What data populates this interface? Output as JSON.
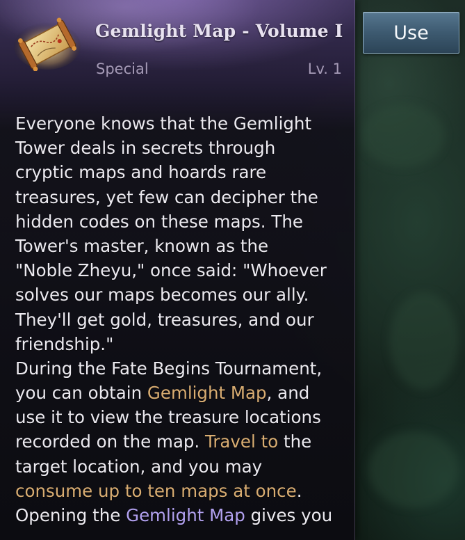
{
  "item": {
    "icon": "treasure-map-scroll-icon",
    "name": "Gemlight Map - Volume I",
    "category": "Special",
    "level": "Lv. 1"
  },
  "colors": {
    "text": "#eceaf0",
    "subtext": "#a59ab6",
    "highlight_gold": "#d9ad72",
    "highlight_purple": "#b2a1f0",
    "button": "#3d5a70"
  },
  "description": {
    "l1": "Everyone knows that the Gemlight",
    "l2": "Tower deals in secrets through",
    "l3": "cryptic maps and hoards rare",
    "l4": "treasures, yet few can decipher the",
    "l5": "hidden codes on these maps. The",
    "l6": "Tower's master, known as the",
    "l7": "\"Noble Zheyu,\" once said: \"Whoever",
    "l8": "solves our maps becomes our ally.",
    "l9": "They'll get gold, treasures, and our",
    "l10": "friendship.\"",
    "l11": "During the Fate Begins Tournament,",
    "l12a": "you can obtain ",
    "l12b": "Gemlight Map",
    "l12c": ", and",
    "l13": "use it to view the treasure locations",
    "l14a": "recorded on the map. ",
    "l14b": "Travel to",
    "l14c": " the",
    "l15": "target location, and you may",
    "l16a": "consume up to ten maps at once",
    "l16b": ".",
    "l17a": "Opening the ",
    "l17b": "Gemlight Map",
    "l17c": " gives you"
  },
  "use_button": {
    "label": "Use"
  }
}
